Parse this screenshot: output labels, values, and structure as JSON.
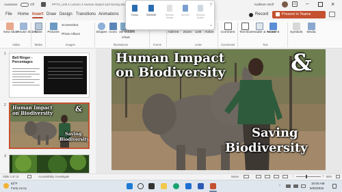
{
  "titlebar": {
    "autosave": "AutoSave",
    "autosave_state": "Off",
    "doc_title": "PPTX_Unit 1 Lesson 4 Human Impact and Saving Biodiversity",
    "user_name": "Kathleen Wolf"
  },
  "menu": {
    "items": [
      "File",
      "Home",
      "Insert",
      "Draw",
      "Design",
      "Transitions",
      "Animations"
    ],
    "active": "Insert",
    "record_label": "Record",
    "present_label": "Present in Teams"
  },
  "popup": {
    "items": [
      "Focus",
      "SNNNW",
      "Screen Areas",
      "Screen",
      "Record Audio"
    ]
  },
  "ribbon": {
    "buttons": {
      "new_slide": "New Slide",
      "reuse_slides": "Reuse Slides",
      "table": "Table",
      "pictures": "Pictures",
      "screenshot": "Screenshot",
      "photo_album": "Photo Album",
      "shapes": "Shapes",
      "icons": "Icons",
      "models": "3D Models",
      "smartart": "SmartArt",
      "chart": "Chart",
      "forms": "Forms",
      "addins": "Add-ins",
      "zoom": "Zoom",
      "link": "Link",
      "action": "Action",
      "comment": "Comment",
      "text_box": "Text Box",
      "header_footer": "Header & Footer",
      "wordart": "WordArt",
      "symbols": "Symbols",
      "media": "Media"
    },
    "groups": [
      "Slides",
      "Tables",
      "Images",
      "Illustrations",
      "Forms",
      "Links",
      "Comments",
      "Text"
    ]
  },
  "thumbnails": [
    {
      "num": "1",
      "title": "Bell Ringer - Percentages"
    },
    {
      "num": "2",
      "title_line1": "Human Impact",
      "title_line2": "on Biodiversity",
      "amp": "&",
      "title_line3": "Saving",
      "title_line4": "Biodiversity"
    },
    {
      "num": "3"
    }
  ],
  "slide": {
    "title_line1": "Human Impact",
    "title_line2": "on Biodiversity",
    "amp": "&",
    "sub_line1": "Saving",
    "sub_line2": "Biodiversity"
  },
  "status": {
    "slide_of": "Slide 2 of 13",
    "accessibility": "Accessibility: Investigate",
    "notes": "Notes",
    "zoom": "65%"
  },
  "taskbar": {
    "temp": "63°F",
    "weather": "Partly sunny",
    "time": "10:00 AM",
    "date": "6/20/2022"
  },
  "colors": {
    "accent": "#b7472a",
    "taskbar": "#dfe6ee"
  }
}
